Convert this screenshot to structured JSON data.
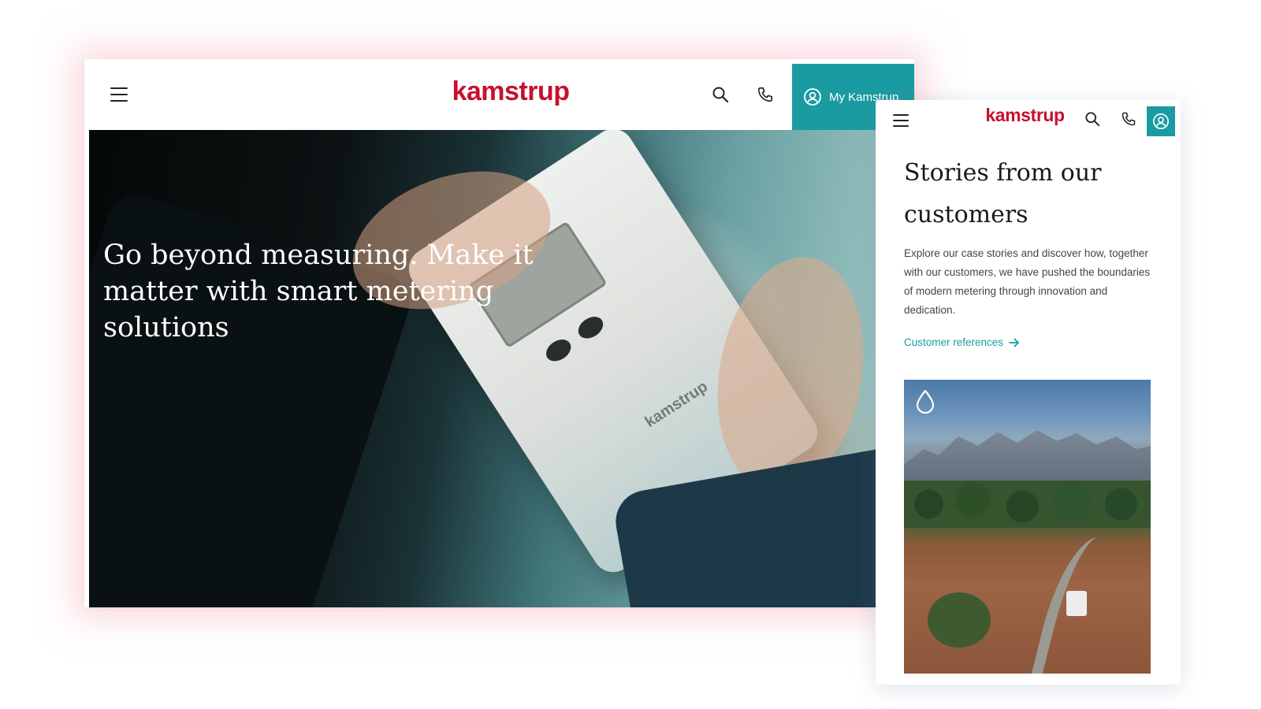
{
  "desktop": {
    "header": {
      "logo_text": "kamstrup",
      "my_kamstrup_label": "My Kamstrup",
      "icons": [
        "menu-icon",
        "search-icon",
        "phone-icon",
        "user-circle-icon"
      ]
    },
    "hero": {
      "headline": "Go beyond measuring. Make it matter with smart metering solutions"
    }
  },
  "mobile": {
    "header": {
      "logo_text": "kamstrup",
      "icons": [
        "menu-icon",
        "search-icon",
        "phone-icon",
        "user-circle-icon"
      ]
    },
    "section": {
      "title": "Stories from our customers",
      "body": "Explore our case stories and discover how, together with our customers, we have pushed the boundaries of modern metering through innovation and dedication.",
      "link_label": "Customer references"
    },
    "card": {
      "icon": "water-drop-icon"
    }
  },
  "colors": {
    "brand_red": "#c8102e",
    "accent_teal": "#1a9ba1",
    "text_dark": "#1a1a1a"
  }
}
